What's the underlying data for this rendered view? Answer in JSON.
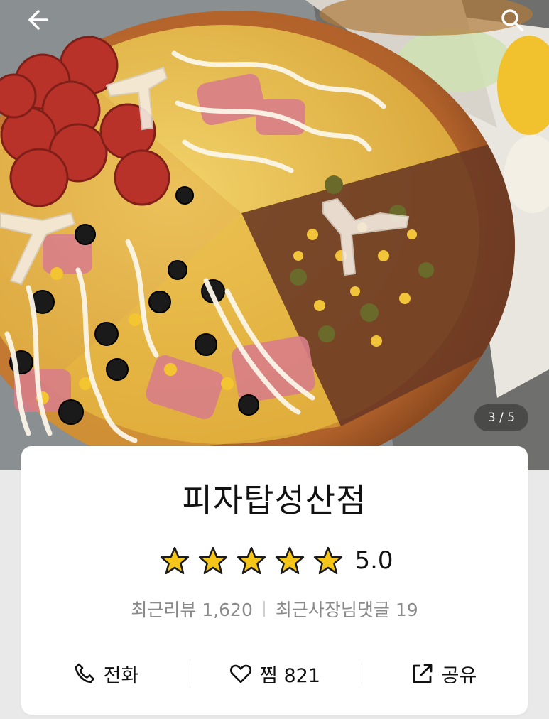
{
  "header": {
    "back_icon": "back-arrow-icon",
    "search_icon": "search-icon"
  },
  "gallery": {
    "counter": "3 / 5"
  },
  "store": {
    "name": "피자탑성산점",
    "rating": "5.0",
    "rating_fraction": 1.0,
    "star_color": "#f5c518",
    "reviews": "최근리뷰 1,620",
    "owner_replies": "최근사장님댓글 19"
  },
  "actions": [
    {
      "icon": "phone-icon",
      "label": "전화"
    },
    {
      "icon": "heart-icon",
      "label": "찜 821"
    },
    {
      "icon": "share-icon",
      "label": "공유"
    }
  ]
}
